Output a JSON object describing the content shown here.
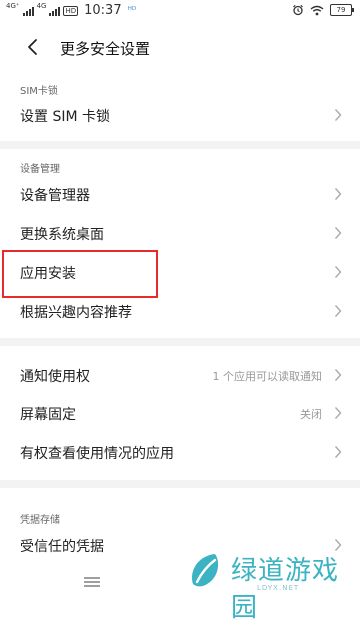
{
  "status_bar": {
    "signal1_label": "4G⁺",
    "signal2_label": "4G",
    "hd_label": "HD",
    "time": "10:37",
    "extra": "ᴴᴰ",
    "battery": "79"
  },
  "header": {
    "title": "更多安全设置"
  },
  "sections": {
    "sim": {
      "label": "SIM卡锁",
      "items": [
        {
          "label": "设置 SIM 卡锁"
        }
      ]
    },
    "device": {
      "label": "设备管理",
      "items": [
        {
          "label": "设备管理器"
        },
        {
          "label": "更换系统桌面"
        },
        {
          "label": "应用安装"
        },
        {
          "label": "根据兴趣内容推荐"
        }
      ]
    },
    "other": {
      "items": [
        {
          "label": "通知使用权",
          "value": "1 个应用可以读取通知"
        },
        {
          "label": "屏幕固定",
          "value": "关闭"
        },
        {
          "label": "有权查看使用情况的应用"
        }
      ]
    },
    "credentials": {
      "label": "凭据存储",
      "items": [
        {
          "label": "受信任的凭据"
        }
      ]
    }
  },
  "watermark": {
    "text": "绿道游戏园",
    "sub": "LDYX.NET"
  },
  "colors": {
    "highlight": "#e82a2a",
    "watermark": "#3bb3c3",
    "divider": "#f3f3f3"
  }
}
